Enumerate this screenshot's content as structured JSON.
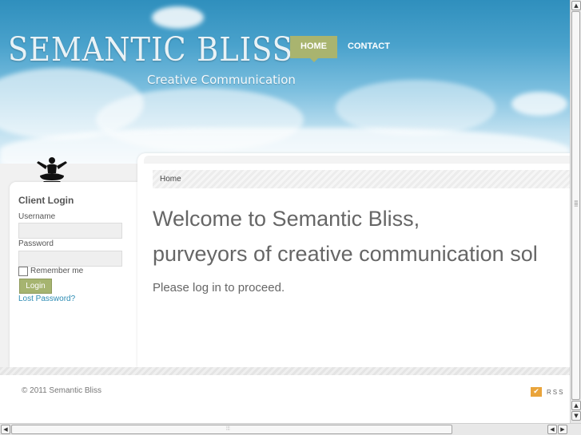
{
  "header": {
    "logo_text": "SEMANTIC BLISS",
    "tagline": "Creative Communication",
    "nav": [
      {
        "label": "HOME",
        "active": true
      },
      {
        "label": "CONTACT",
        "active": false
      }
    ]
  },
  "sidebar": {
    "login_title": "Client Login",
    "username_label": "Username",
    "username_value": "",
    "password_label": "Password",
    "password_value": "",
    "remember_label": "Remember me",
    "remember_checked": false,
    "login_button": "Login",
    "lost_password_link": "Lost Password?"
  },
  "main": {
    "breadcrumb": "Home",
    "welcome_line1": "Welcome to Semantic Bliss,",
    "welcome_line2": "purveyors of creative communication sol",
    "proceed_text": "Please log in to proceed."
  },
  "footer": {
    "copyright": "© 2011 Semantic Bliss",
    "rss_label": "RSS"
  },
  "colors": {
    "nav_active": "#a9b46f",
    "link": "#2b8bb3",
    "login_button": "#a6b470",
    "rss_icon": "#e9a43b"
  },
  "icons": {
    "mascot": "meditating-figure-icon",
    "rss": "rss-checkmark-icon"
  }
}
